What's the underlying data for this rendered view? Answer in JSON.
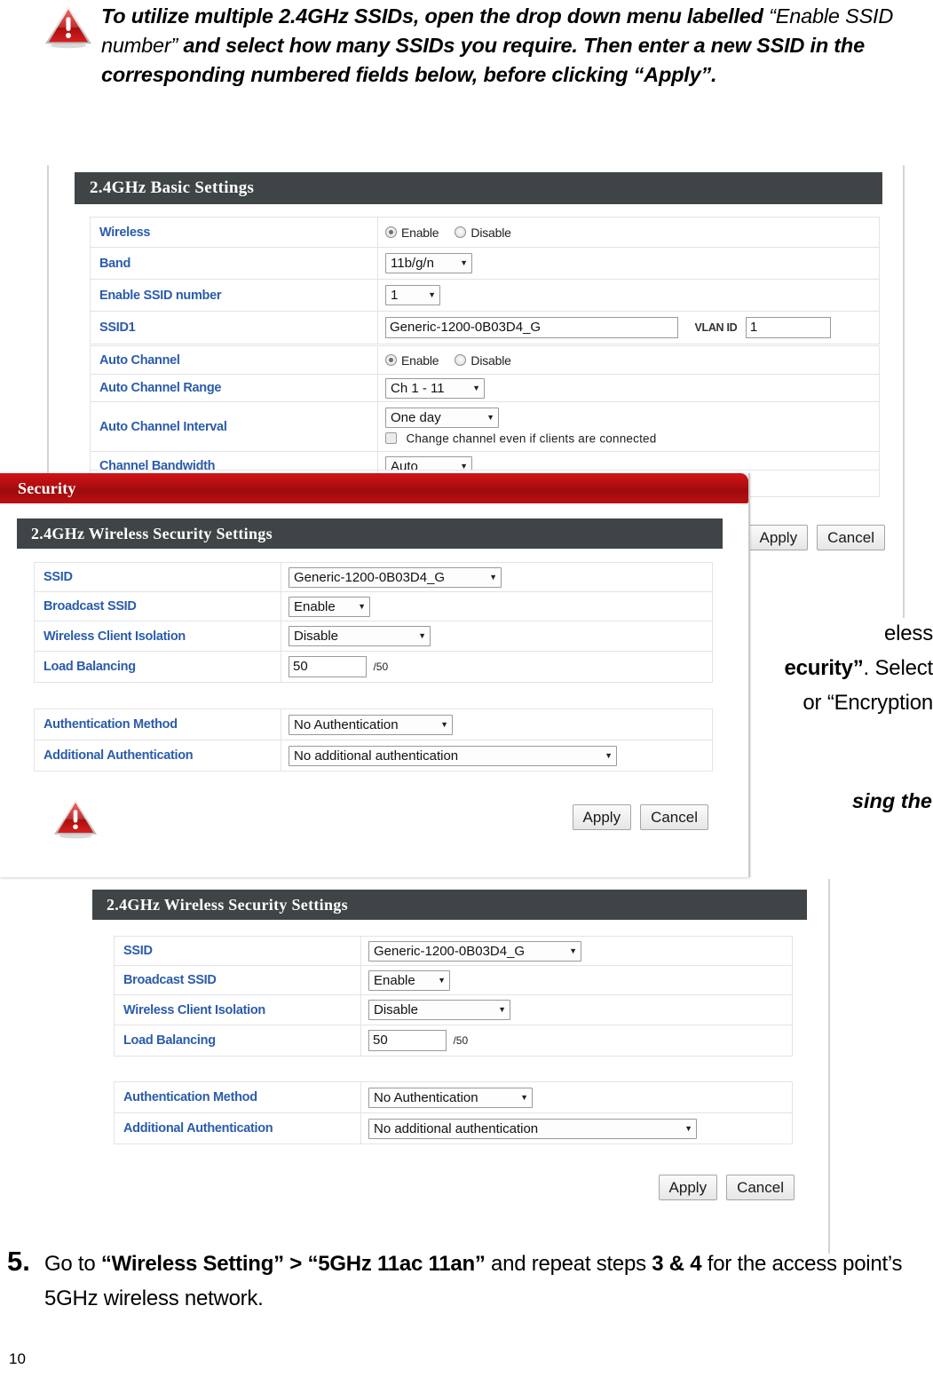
{
  "note_top": {
    "icon": "warning-triangle-icon",
    "segments": [
      {
        "text": "To utilize multiple 2.4GHz SSIDs, open the drop down menu labelled ",
        "style": "bold-italic"
      },
      {
        "text": "“Enable SSID number”",
        "style": "italic"
      },
      {
        "text": " and select how many SSIDs you require. Then enter a new SSID in the corresponding numbered fields below, before clicking “Apply”.",
        "style": "bold-italic"
      }
    ]
  },
  "basic_panel": {
    "header": "2.4GHz Basic Settings",
    "rows_group1": [
      {
        "label": "Wireless",
        "type": "radio",
        "options": [
          "Enable",
          "Disable"
        ],
        "selected": "Enable"
      },
      {
        "label": "Band",
        "type": "select",
        "value": "11b/g/n"
      },
      {
        "label": "Enable SSID number",
        "type": "select",
        "value": "1"
      },
      {
        "label": "SSID1",
        "type": "text-vlan",
        "value": "Generic-1200-0B03D4_G",
        "vlan_label": "VLAN ID",
        "vlan_value": "1"
      }
    ],
    "rows_group2": [
      {
        "label": "Auto Channel",
        "type": "radio",
        "options": [
          "Enable",
          "Disable"
        ],
        "selected": "Enable"
      },
      {
        "label": "Auto Channel Range",
        "type": "select",
        "value": "Ch 1 - 11"
      },
      {
        "label": "Auto Channel Interval",
        "type": "select-check",
        "value": "One day",
        "checkbox_label": "Change channel even if clients are connected",
        "checked": false
      },
      {
        "label": "Channel Bandwidth",
        "type": "select",
        "value": "Auto"
      }
    ],
    "buttons": {
      "apply": "Apply",
      "cancel": "Cancel"
    }
  },
  "security_overlay": {
    "window_title": "Security",
    "header": "2.4GHz Wireless Security Settings",
    "rows_group_a": [
      {
        "label": "SSID",
        "type": "select",
        "value": "Generic-1200-0B03D4_G"
      },
      {
        "label": "Broadcast SSID",
        "type": "select",
        "value": "Enable"
      },
      {
        "label": "Wireless Client Isolation",
        "type": "select",
        "value": "Disable"
      },
      {
        "label": "Load Balancing",
        "type": "text",
        "value": "50",
        "suffix": "/50"
      }
    ],
    "rows_group_b": [
      {
        "label": "Authentication Method",
        "type": "select",
        "value": "No Authentication"
      },
      {
        "label": "Additional Authentication",
        "type": "select",
        "value": "No additional authentication"
      }
    ],
    "buttons": {
      "apply": "Apply",
      "cancel": "Cancel"
    },
    "warning_icon": "warning-triangle-icon"
  },
  "security_panel_bottom": {
    "header": "2.4GHz Wireless Security Settings",
    "rows_group_a": [
      {
        "label": "SSID",
        "type": "select",
        "value": "Generic-1200-0B03D4_G"
      },
      {
        "label": "Broadcast SSID",
        "type": "select",
        "value": "Enable"
      },
      {
        "label": "Wireless Client Isolation",
        "type": "select",
        "value": "Disable"
      },
      {
        "label": "Load Balancing",
        "type": "text",
        "value": "50",
        "suffix": "/50"
      }
    ],
    "rows_group_b": [
      {
        "label": "Authentication Method",
        "type": "select",
        "value": "No Authentication"
      },
      {
        "label": "Additional Authentication",
        "type": "select",
        "value": "No additional authentication"
      }
    ],
    "buttons": {
      "apply": "Apply",
      "cancel": "Cancel"
    }
  },
  "body_paragraph": {
    "line1_visible": "eless",
    "line2_visible_bold": "ecurity”",
    "line2_visible_rest": ". Select",
    "line3_visible": "or “Encryption"
  },
  "note_mid": {
    "visible_text": "sing the"
  },
  "step5": {
    "number": "5.",
    "part1": "Go to ",
    "bold1": "“Wireless Setting” > “5GHz 11ac 11an”",
    "part2": " and repeat steps ",
    "bold2": "3 & 4",
    "part3": " for the access point’s 5GHz wireless network."
  },
  "page_number": "10",
  "colors": {
    "panel_header_bg": "#3f4447",
    "label_text": "#2b5cab",
    "security_bar_red": "#b81114",
    "frame_line": "#d4d4d4"
  }
}
